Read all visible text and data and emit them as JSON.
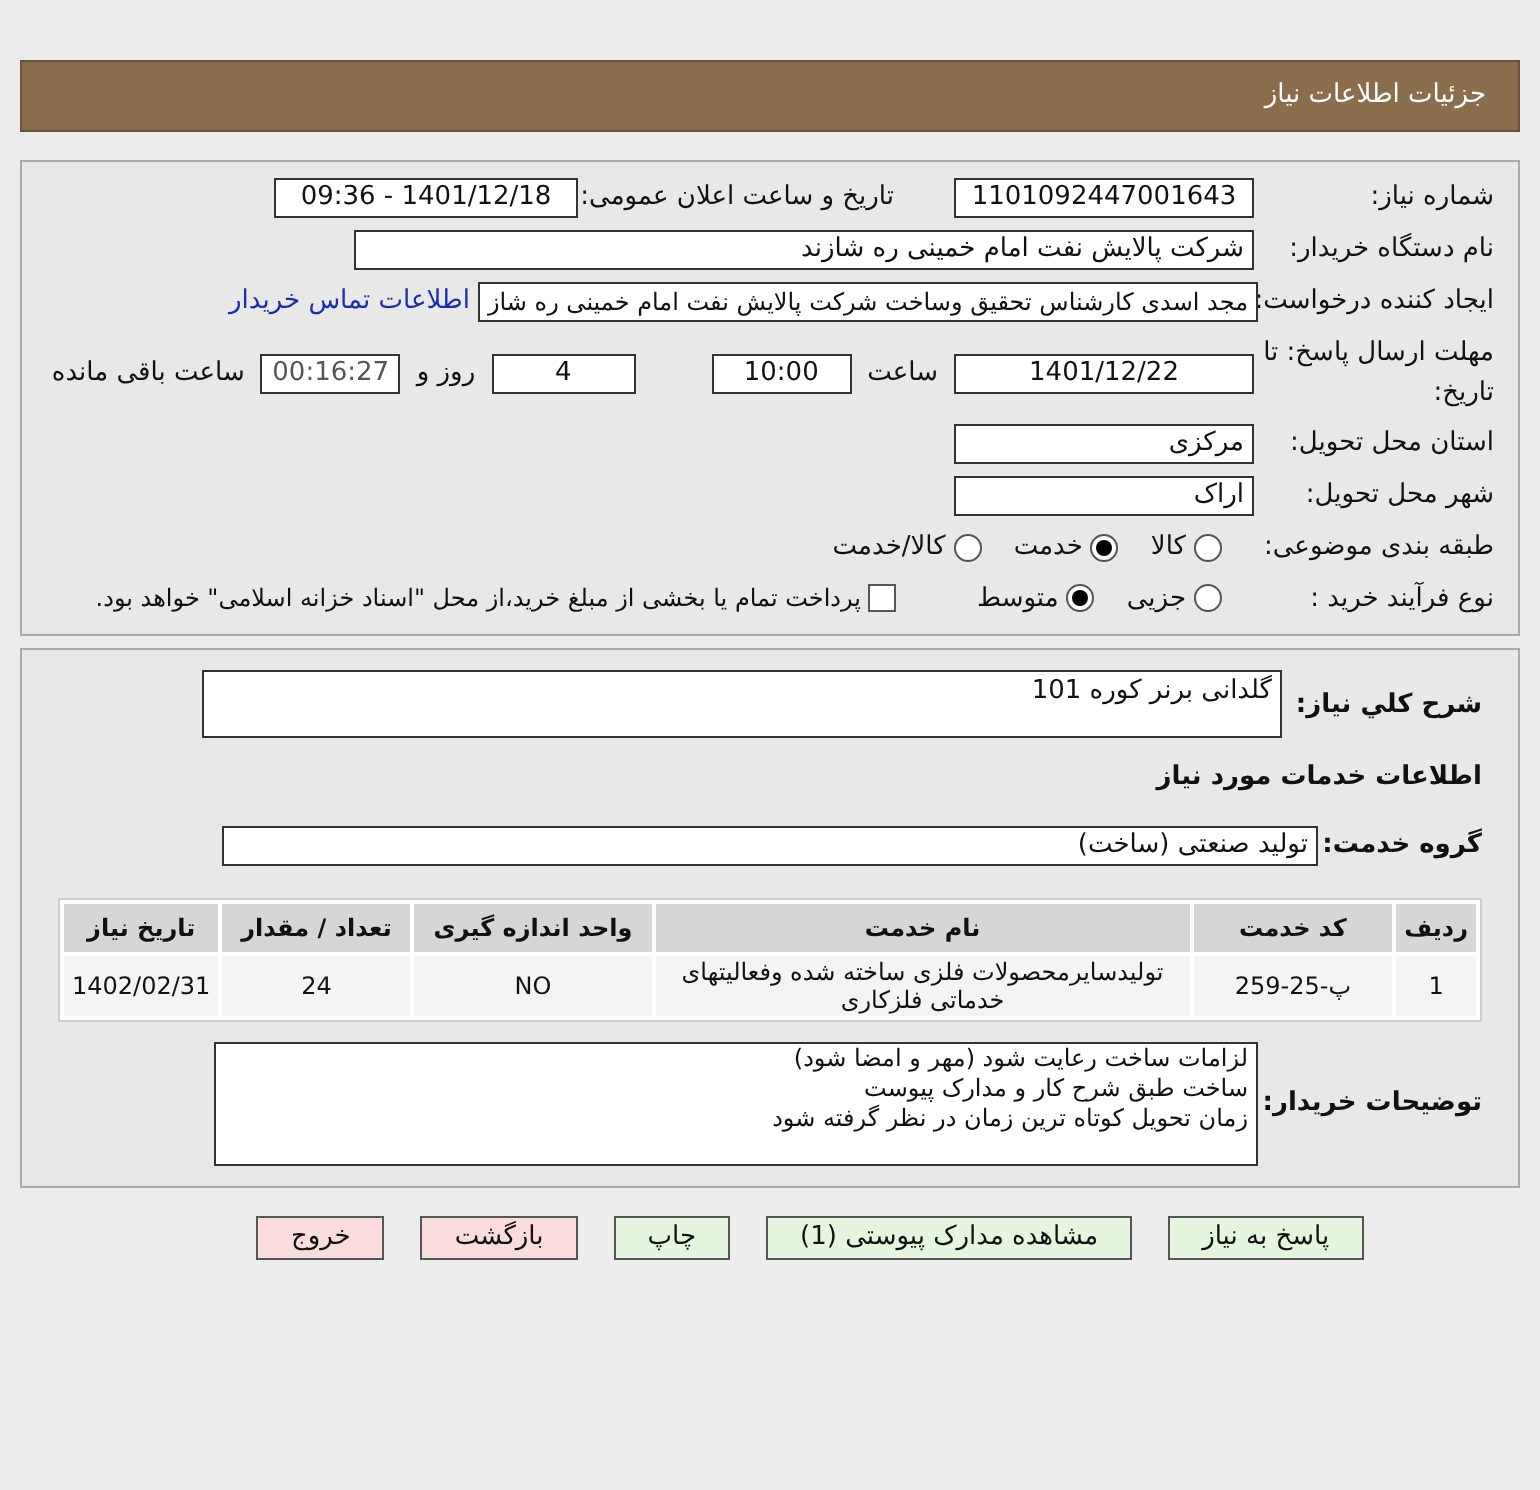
{
  "header": {
    "title": "جزئیات اطلاعات نیاز"
  },
  "details": {
    "need_number": {
      "label": "شماره نیاز:",
      "value": "1101092447001643"
    },
    "announce": {
      "label": "تاریخ و ساعت اعلان عمومی:",
      "value": "1401/12/18 - 09:36"
    },
    "buyer_org": {
      "label": "نام دستگاه خریدار:",
      "value": "شرکت پالایش نفت امام خمینی  ره  شازند"
    },
    "creator": {
      "label": "ایجاد کننده درخواست:",
      "value": "مجد اسدی کارشناس تحقیق وساخت شرکت پالایش نفت امام خمینی  ره  شاز",
      "link": "اطلاعات تماس خریدار"
    },
    "deadline": {
      "label": "مهلت ارسال پاسخ: تا تاریخ:",
      "date": "1401/12/22",
      "time_label": "ساعت",
      "time": "10:00",
      "days": "4",
      "days_label": "روز و",
      "remaining": "00:16:27",
      "remaining_label": "ساعت باقی مانده"
    },
    "province": {
      "label": "استان محل تحویل:",
      "value": "مرکزی"
    },
    "city": {
      "label": "شهر محل تحویل:",
      "value": "اراک"
    },
    "category": {
      "label": "طبقه بندی موضوعی:",
      "options": [
        {
          "label": "کالا",
          "selected": false
        },
        {
          "label": "خدمت",
          "selected": true
        },
        {
          "label": "کالا/خدمت",
          "selected": false
        }
      ]
    },
    "process": {
      "label": "نوع فرآیند خرید :",
      "options": [
        {
          "label": "جزیی",
          "selected": false
        },
        {
          "label": "متوسط",
          "selected": true
        }
      ],
      "payment": {
        "checked": false,
        "text": "پرداخت تمام یا بخشی از مبلغ خرید،از محل \"اسناد خزانه اسلامی\" خواهد بود."
      }
    }
  },
  "summary": {
    "label": "شرح کلي نیاز:",
    "value": "گلدانی برنر کوره 101"
  },
  "services_heading": "اطلاعات خدمات مورد نیاز",
  "service_group": {
    "label": "گروه خدمت:",
    "value": "تولید صنعتی (ساخت)"
  },
  "table": {
    "columns": [
      "ردیف",
      "کد خدمت",
      "نام خدمت",
      "واحد اندازه گیری",
      "تعداد / مقدار",
      "تاریخ نیاز"
    ],
    "rows": [
      [
        "1",
        "پ-25-259",
        "تولیدسایرمحصولات فلزی ساخته شده وفعالیتهای خدماتی فلزکاری",
        "NO",
        "24",
        "1402/02/31"
      ]
    ]
  },
  "buyer_notes": {
    "label": "توضیحات خریدار:",
    "lines": [
      "لزامات ساخت رعایت شود (مهر و امضا شود)",
      "ساخت طبق شرح کار و مدارک پیوست",
      "زمان تحویل کوتاه ترین زمان در نظر گرفته شود"
    ]
  },
  "buttons": [
    {
      "label": "پاسخ به نیاز",
      "kind": "green"
    },
    {
      "label": "مشاهده مدارک پیوستی (1)",
      "kind": "green"
    },
    {
      "label": "چاپ",
      "kind": "green"
    },
    {
      "label": "بازگشت",
      "kind": "red"
    },
    {
      "label": "خروج",
      "kind": "red"
    }
  ]
}
